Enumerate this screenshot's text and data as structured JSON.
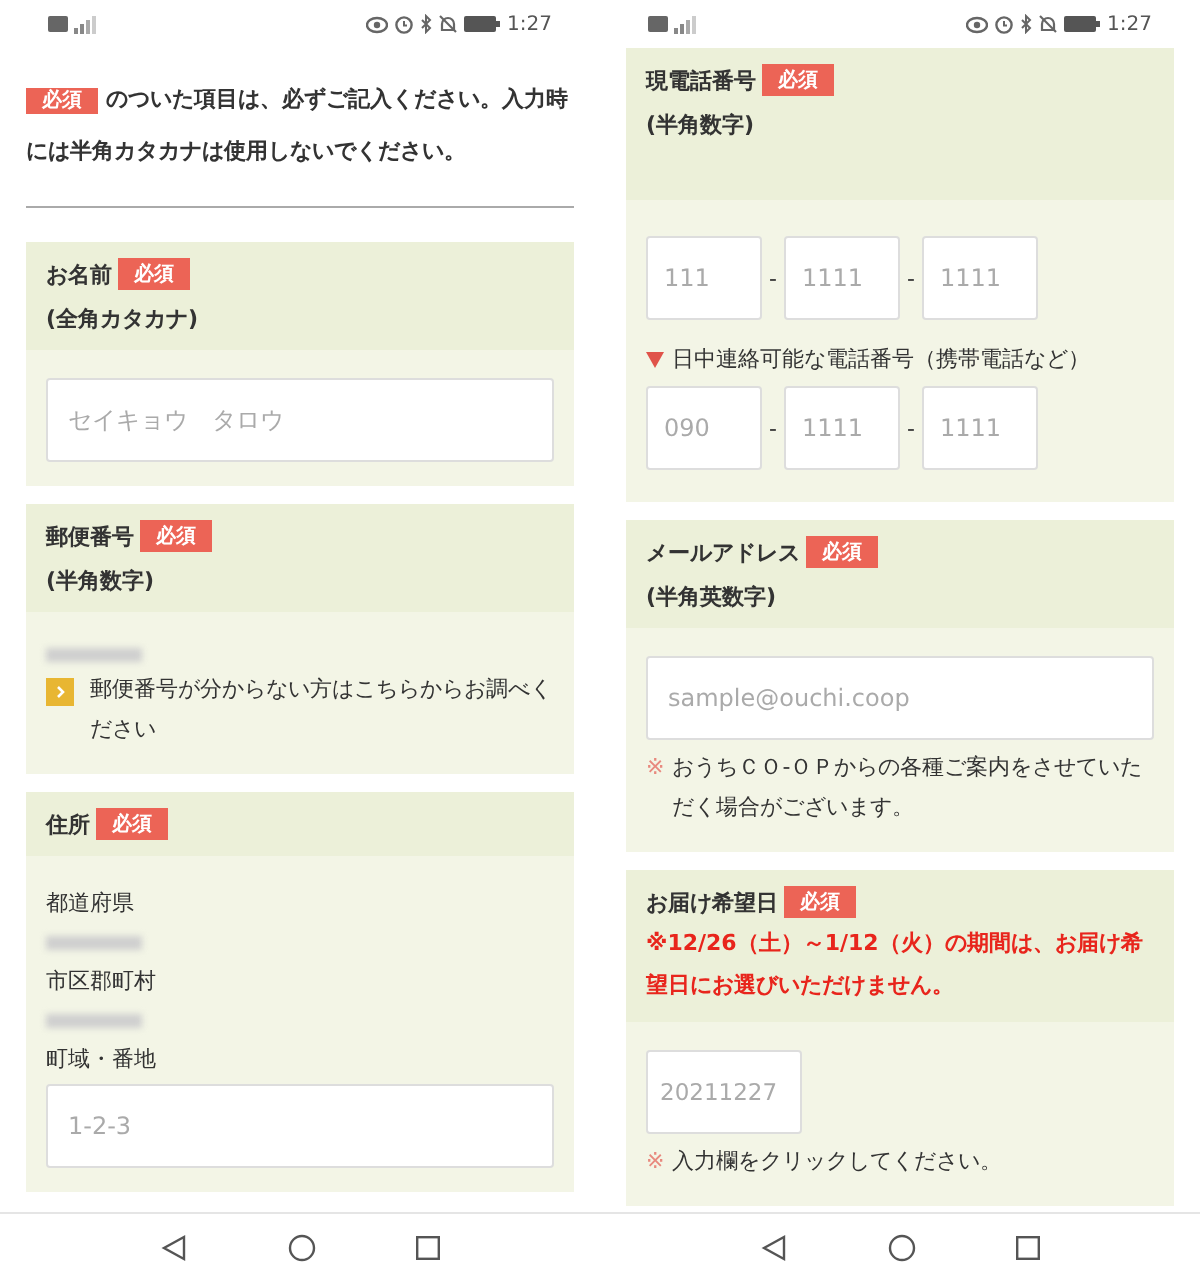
{
  "screens": [
    {
      "status_bar": {
        "time": "1:27"
      },
      "intro": {
        "badge": "必須",
        "text": "のついた項目は、必ずご記入ください。入力時には半角カタカナは使用しないでください。"
      },
      "sections": [
        {
          "title": "お名前",
          "badge": "必須",
          "subtitle": "(全角カタカナ)",
          "items": [
            {
              "kind": "input",
              "placeholder": "セイキョウ　タロウ"
            }
          ]
        },
        {
          "title": "郵便番号",
          "badge": "必須",
          "subtitle": "(半角数字)",
          "items": [
            {
              "kind": "blurred"
            },
            {
              "kind": "link",
              "text": "郵便番号が分からない方はこちらからお調べください"
            }
          ]
        },
        {
          "title": "住所",
          "badge": "必須",
          "items": [
            {
              "kind": "label",
              "text": "都道府県"
            },
            {
              "kind": "blurred"
            },
            {
              "kind": "label",
              "text": "市区郡町村"
            },
            {
              "kind": "blurred"
            },
            {
              "kind": "label",
              "text": "町域・番地"
            },
            {
              "kind": "input",
              "placeholder": "1-2-3"
            }
          ]
        }
      ]
    },
    {
      "status_bar": {
        "time": "1:27"
      },
      "sections": [
        {
          "title": "現電話番号",
          "badge": "必須",
          "subtitle": "(半角数字)",
          "tall": true,
          "items": [
            {
              "kind": "phone",
              "placeholders": [
                "111",
                "1111",
                "1111"
              ],
              "separators": [
                "-",
                "-"
              ]
            },
            {
              "kind": "subheading",
              "text": "日中連絡可能な電話番号（携帯電話など）"
            },
            {
              "kind": "phone",
              "placeholders": [
                "090",
                "1111",
                "1111"
              ],
              "separators": [
                "-",
                "-"
              ]
            }
          ]
        },
        {
          "title": "メールアドレス",
          "badge": "必須",
          "subtitle": "(半角英数字)",
          "items": [
            {
              "kind": "input",
              "placeholder": "sample@ouchi.coop"
            },
            {
              "kind": "note",
              "mark": "※",
              "text": "おうちＣＯ-ＯＰからの各種ご案内をさせていただく場合がございます。"
            }
          ]
        },
        {
          "title": "お届け希望日",
          "badge": "必須",
          "warning": "※12/26（土）～1/12（火）の期間は、お届け希望日にお選びいただけません。",
          "items": [
            {
              "kind": "date",
              "placeholder": "20211227"
            },
            {
              "kind": "note",
              "mark": "※",
              "text": "入力欄をクリックしてください。"
            }
          ]
        }
      ]
    }
  ]
}
